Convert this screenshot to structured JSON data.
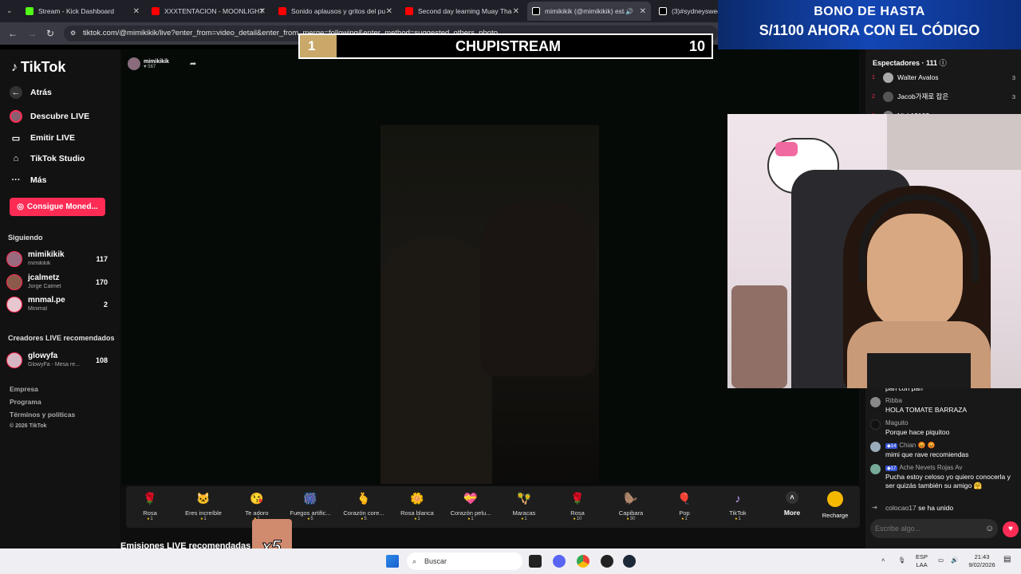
{
  "browser": {
    "tabs": [
      {
        "title": "Stream - Kick Dashboard",
        "color": "#53fc18"
      },
      {
        "title": "XXXTENTACION - MOONLIGHT",
        "color": "#ff0000"
      },
      {
        "title": "Sonido aplausos y gritos del pu",
        "color": "#ff0000"
      },
      {
        "title": "Second day learning Muay Tha",
        "color": "#ff0000"
      },
      {
        "title": "mimikikik (@mimikikik) está",
        "color": "#ffffff"
      },
      {
        "title": "(3)#sydneysweer",
        "color": "#ffffff"
      }
    ],
    "url": "tiktok.com/@mimikikik/live?enter_from=video_detail&enter_from_merge=following&enter_method=suggested_others_photo"
  },
  "ad": {
    "line1": "BONO DE HASTA",
    "line2": "S/1100 AHORA CON EL CÓDIGO"
  },
  "scoreboard": {
    "left": "1",
    "title": "CHUPISTREAM",
    "right": "10"
  },
  "sidebar": {
    "logo": "TikTok",
    "nav": [
      {
        "label": "Atrás",
        "icon": "back-arrow-icon"
      },
      {
        "label": "Descubre LIVE",
        "icon": "live-avatar-icon"
      },
      {
        "label": "Emitir LIVE",
        "icon": "camera-icon"
      },
      {
        "label": "TikTok Studio",
        "icon": "home-icon"
      },
      {
        "label": "Más",
        "icon": "more-dots-icon"
      }
    ],
    "coins_button": "Consigue Moned...",
    "following_header": "Siguiendo",
    "following": [
      {
        "name": "mimikikik",
        "sub": "mimikikik",
        "count": "117",
        "color": "#9a6a7e"
      },
      {
        "name": "jcalmetz",
        "sub": "Jorge Calmet",
        "count": "170",
        "color": "#8c5a4a"
      },
      {
        "name": "mnmal.pe",
        "sub": "Minimal",
        "count": "2",
        "color": "#e9c7d0"
      }
    ],
    "recommended_header": "Creadores LIVE recomendados",
    "recommended": [
      {
        "name": "glowyfa",
        "sub": "GlowyFa - Mesa re...",
        "count": "108",
        "color": "#d6b6c2"
      }
    ],
    "footer": [
      "Empresa",
      "Programa",
      "Términos y políticas",
      "© 2026 TikTok"
    ]
  },
  "stream": {
    "host": "mimikikik",
    "viewers": "567",
    "recommended_title": "Emisiones LIVE recomendadas",
    "combo": "x5"
  },
  "gifts": [
    {
      "name": "Rosa",
      "price": "1",
      "icon": "🌹"
    },
    {
      "name": "Eres increíble",
      "price": "1",
      "icon": "🐱"
    },
    {
      "name": "Te adoro",
      "price": "1",
      "icon": "😘"
    },
    {
      "name": "Fuegos artific...",
      "price": "5",
      "icon": "🎆"
    },
    {
      "name": "Corazón core...",
      "price": "5",
      "icon": "🫰"
    },
    {
      "name": "Rosa blanca",
      "price": "1",
      "icon": "🌼"
    },
    {
      "name": "Corazón pelu...",
      "price": "1",
      "icon": "💝"
    },
    {
      "name": "Maracas",
      "price": "1",
      "icon": "🪇"
    },
    {
      "name": "Rosa",
      "price": "10",
      "icon": "🌹"
    },
    {
      "name": "Capibara",
      "price": "30",
      "icon": "🦫"
    },
    {
      "name": "Pop",
      "price": "1",
      "icon": "🎈"
    },
    {
      "name": "TikTok",
      "price": "1",
      "icon": "♪"
    }
  ],
  "gift_more": "More",
  "recharge": "Recharge",
  "viewers_panel": {
    "title": "Espectadores · 111",
    "list": [
      {
        "rank": "1",
        "name": "Walter Avalos",
        "score": "3",
        "color": "#aaa"
      },
      {
        "rank": "2",
        "name": "Jacob가재로 잡은",
        "score": "3",
        "color": "#555"
      },
      {
        "rank": "3",
        "name": "Nick13102",
        "score": "",
        "color": "#777"
      }
    ]
  },
  "chat": {
    "partial": "pan con pan",
    "messages": [
      {
        "user": "Ribba",
        "badge": "",
        "text": "HOLA TOMATE BARRAZA",
        "color": "#888"
      },
      {
        "user": "Maguito",
        "badge": "",
        "text": "Porque hace piquitoo",
        "color": "#111"
      },
      {
        "user": "Chian 😡 😡",
        "badge": "14",
        "text": "mimi que rave recomiendas",
        "color": "#9ab"
      },
      {
        "user": "Ache Nevets Rojas Av",
        "badge": "17",
        "text": "Pucha estoy celoso yo quiero conocerla y ser quizás también su amigo 🤗",
        "color": "#7a9"
      }
    ],
    "join": {
      "user": "colocao17",
      "text": "se ha unido"
    },
    "input_placeholder": "Escribe algo..."
  },
  "taskbar": {
    "search": "Buscar",
    "lang1": "ESP",
    "lang2": "LAA",
    "time": "21:43",
    "date": "9/02/2026"
  }
}
